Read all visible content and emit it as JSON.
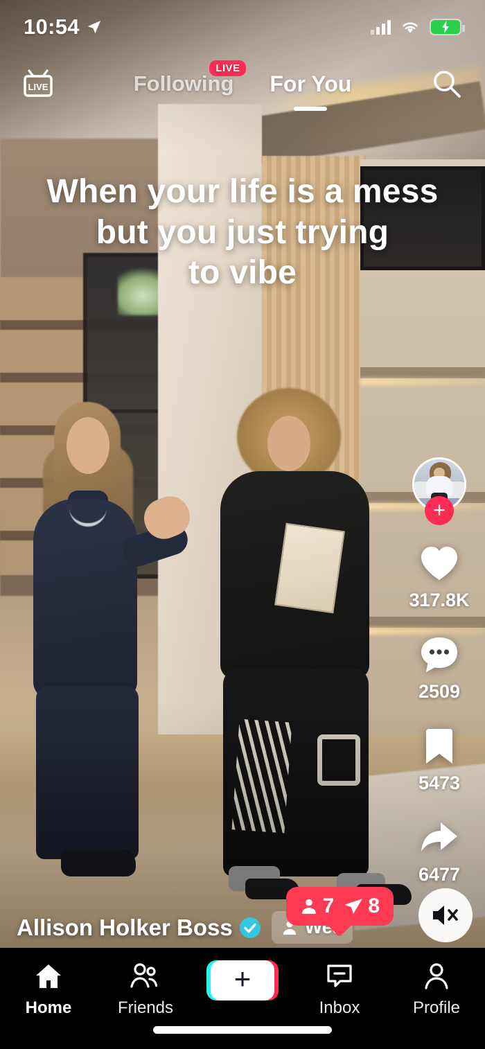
{
  "status_bar": {
    "time": "10:54",
    "location_icon": "location-arrow-icon",
    "signal_icon": "cellular-signal-icon",
    "wifi_icon": "wifi-icon",
    "battery_icon": "battery-charging-icon",
    "battery_color": "#2bd04a"
  },
  "top_nav": {
    "live_button_label": "LIVE",
    "tabs": [
      {
        "label": "Following",
        "active": false,
        "badge": "LIVE"
      },
      {
        "label": "For You",
        "active": true,
        "badge": ""
      }
    ],
    "search_icon": "search-icon"
  },
  "video": {
    "caption_line1": "When your life is a mess",
    "caption_line2": "but you just trying",
    "caption_line3": "to vibe"
  },
  "action_rail": {
    "avatar_name": "creator-avatar",
    "follow_label": "+",
    "actions": [
      {
        "icon": "heart-icon",
        "count": "317.8K",
        "name": "like-button"
      },
      {
        "icon": "comment-icon",
        "count": "2509",
        "name": "comment-button"
      },
      {
        "icon": "bookmark-icon",
        "count": "5473",
        "name": "bookmark-button"
      },
      {
        "icon": "share-icon",
        "count": "6477",
        "name": "share-button"
      }
    ]
  },
  "bottom_info": {
    "username": "Allison Holker Boss",
    "verified_icon": "verified-badge-icon",
    "verified_color": "#33c8e0",
    "tagged_user": "Wes",
    "tag_icon": "person-icon"
  },
  "tooltip": {
    "viewers_icon": "person-icon",
    "viewers_count": "7",
    "shares_icon": "send-icon",
    "shares_count": "8",
    "background_color": "#fe3a53"
  },
  "mute_button": {
    "icon": "speaker-mute-icon",
    "name": "mute-toggle"
  },
  "tab_bar": {
    "items": [
      {
        "label": "Home",
        "icon": "home-icon",
        "active": true
      },
      {
        "label": "Friends",
        "icon": "friends-icon",
        "active": false
      },
      {
        "label": "",
        "icon": "create-plus-icon",
        "active": false
      },
      {
        "label": "Inbox",
        "icon": "inbox-icon",
        "active": false
      },
      {
        "label": "Profile",
        "icon": "profile-icon",
        "active": false
      }
    ],
    "create_label": "+",
    "create_colors": {
      "cyan": "#25f4ee",
      "pink": "#fe2c55"
    }
  }
}
